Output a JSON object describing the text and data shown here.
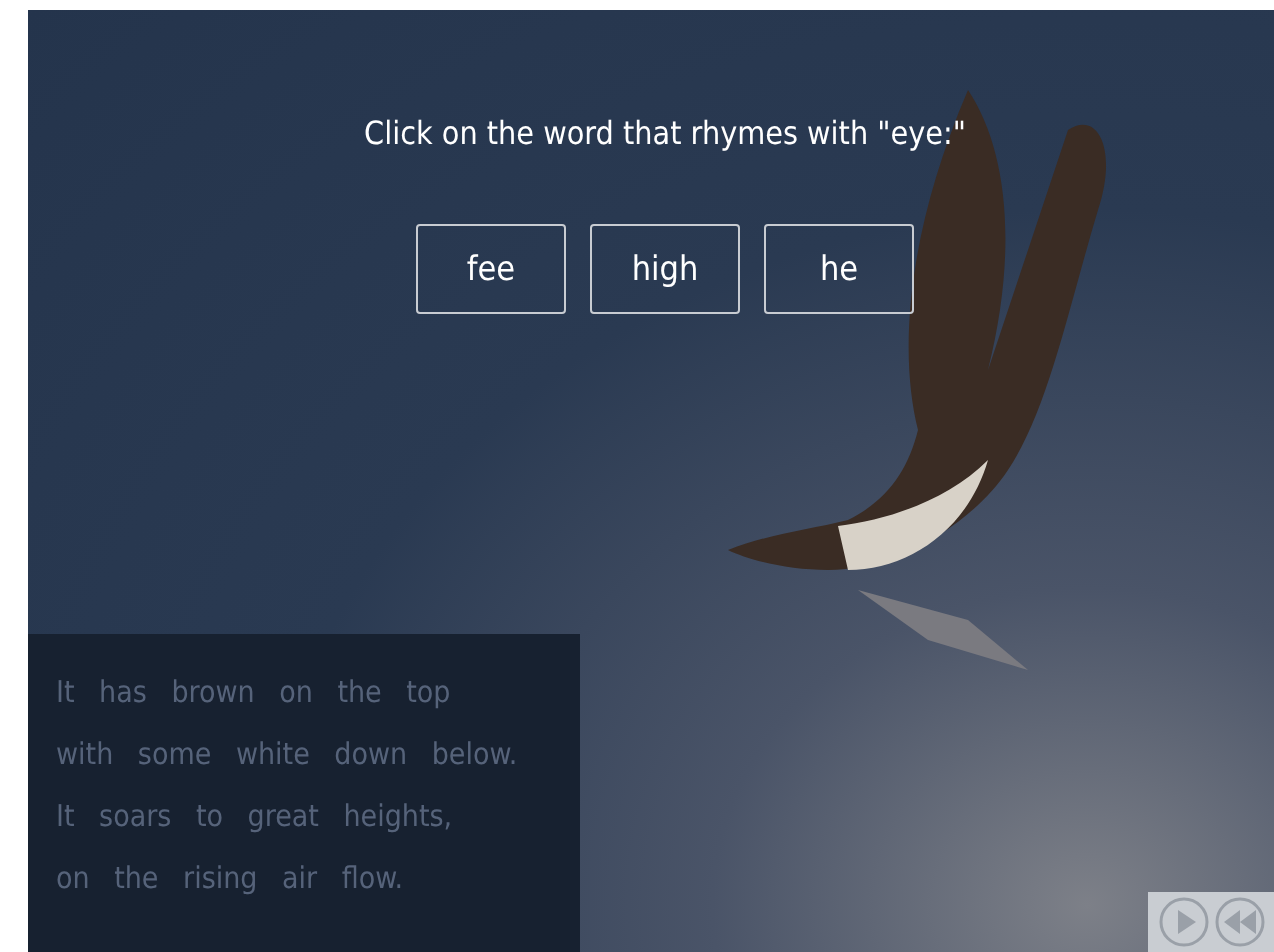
{
  "prompt": "Click on the word that rhymes with \"eye:\"",
  "choices": [
    {
      "label": "fee"
    },
    {
      "label": "high"
    },
    {
      "label": "he"
    }
  ],
  "poem": [
    "It has brown on the top",
    "with some white down below.",
    "It soars to great heights,",
    "on the rising air flow."
  ]
}
